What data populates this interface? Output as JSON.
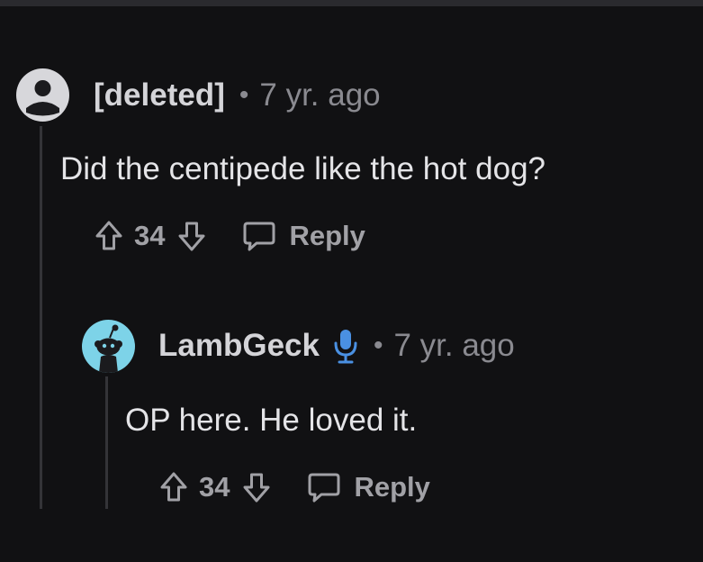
{
  "comments": [
    {
      "username": "[deleted]",
      "separator": "•",
      "time": "7 yr. ago",
      "body": "Did the centipede like the hot dog?",
      "score": "34",
      "reply_label": "Reply",
      "avatar_icon": "default-user-avatar-icon"
    },
    {
      "username": "LambGeck",
      "separator": "•",
      "time": "7 yr. ago",
      "body": "OP here. He loved it.",
      "score": "34",
      "reply_label": "Reply",
      "avatar_icon": "snoo-avatar-icon",
      "badge_icon": "microphone-icon"
    }
  ],
  "colors": {
    "background": "#111113",
    "thread_line": "#343438",
    "mic_badge": "#4a90e2",
    "snoo_avatar_bg": "#7dd3e8"
  }
}
